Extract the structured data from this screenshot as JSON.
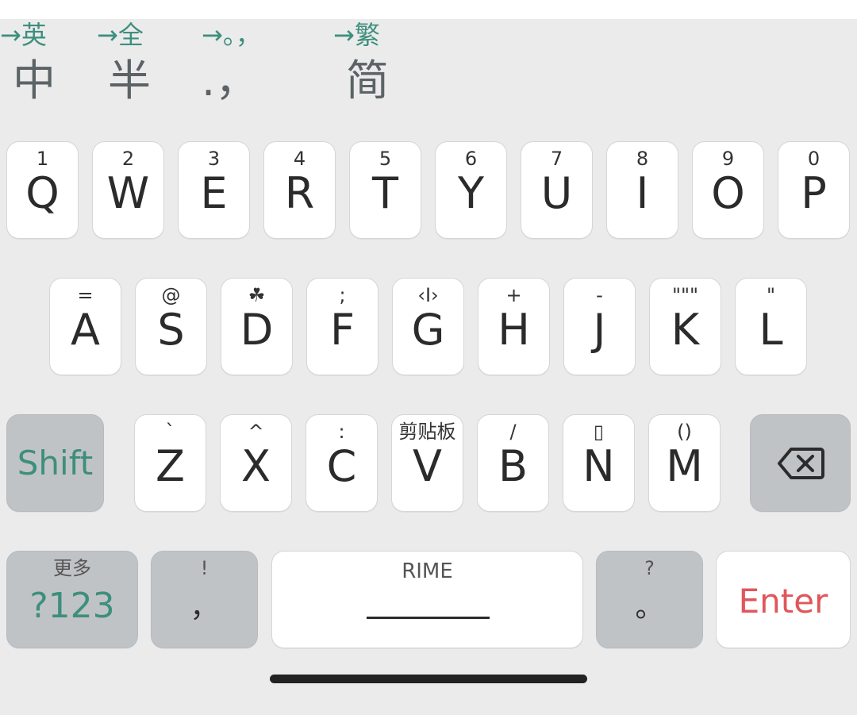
{
  "toggles": [
    {
      "hint": "→英",
      "main": "中"
    },
    {
      "hint": "→全",
      "main": "半"
    },
    {
      "hint": "→。，",
      "main": ".，"
    },
    {
      "hint": "→繁",
      "main": "简"
    }
  ],
  "row1": [
    {
      "label": "Q",
      "sub": "1"
    },
    {
      "label": "W",
      "sub": "2"
    },
    {
      "label": "E",
      "sub": "3"
    },
    {
      "label": "R",
      "sub": "4"
    },
    {
      "label": "T",
      "sub": "5"
    },
    {
      "label": "Y",
      "sub": "6"
    },
    {
      "label": "U",
      "sub": "7"
    },
    {
      "label": "I",
      "sub": "8"
    },
    {
      "label": "O",
      "sub": "9"
    },
    {
      "label": "P",
      "sub": "0"
    }
  ],
  "row2": [
    {
      "label": "A",
      "sub": "="
    },
    {
      "label": "S",
      "sub": "@"
    },
    {
      "label": "D",
      "sub": "☘"
    },
    {
      "label": "F",
      "sub": ";"
    },
    {
      "label": "G",
      "sub": "‹I›"
    },
    {
      "label": "H",
      "sub": "+"
    },
    {
      "label": "J",
      "sub": "-"
    },
    {
      "label": "K",
      "sub": "\"\"\""
    },
    {
      "label": "L",
      "sub": "\""
    }
  ],
  "row3": {
    "shift": "Shift",
    "letters": [
      {
        "label": "Z",
        "sub": "`"
      },
      {
        "label": "X",
        "sub": "^"
      },
      {
        "label": "C",
        "sub": ":"
      },
      {
        "label": "V",
        "sub": "剪贴板"
      },
      {
        "label": "B",
        "sub": "/"
      },
      {
        "label": "N",
        "sub": "▯"
      },
      {
        "label": "M",
        "sub": "()"
      }
    ],
    "backspace_icon": "backspace-icon"
  },
  "row4": {
    "symbols": {
      "label": "?123",
      "sub": "更多"
    },
    "comma": {
      "label": "，",
      "sub": "!"
    },
    "space": {
      "label": "RIME"
    },
    "period": {
      "label": "。",
      "sub": "?"
    },
    "enter": {
      "label": "Enter"
    }
  },
  "colors": {
    "accent_green": "#3d8f7d",
    "enter_red": "#e0575b",
    "key_bg": "#ffffff",
    "function_key_bg": "#c0c3c6",
    "keyboard_bg": "#ebebeb"
  }
}
